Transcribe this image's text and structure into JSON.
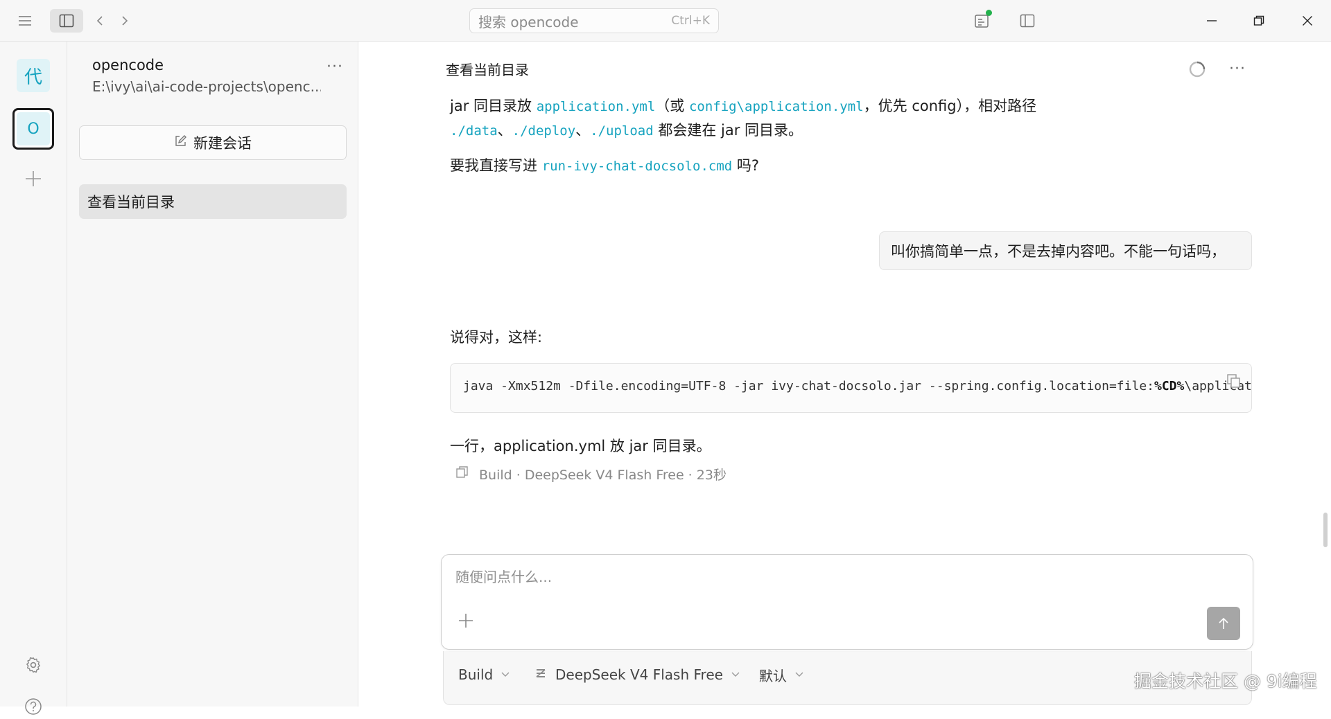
{
  "titlebar": {
    "search_placeholder": "搜索 opencode",
    "search_shortcut": "Ctrl+K",
    "icons": [
      "menu-icon",
      "sidebar-toggle-icon",
      "back-icon",
      "forward-icon",
      "review-icon",
      "panel-icon",
      "minimize-icon",
      "maximize-icon",
      "close-icon"
    ],
    "status_dot_color": "#22b14c"
  },
  "rail": {
    "tile_char": "代",
    "project_char": "O",
    "accent": "#16a3bf"
  },
  "sidebar": {
    "project_name": "opencode",
    "project_path": "E:\\ivy\\ai\\ai-code-projects\\openc...",
    "more": "···",
    "new_session_label": "新建会话",
    "sessions": [
      {
        "label": "查看当前目录",
        "active": true
      }
    ]
  },
  "main": {
    "chat_title": "查看当前目录",
    "more": "···",
    "assistant_prev": {
      "line1_a": "jar 同目录放 ",
      "line1_code1": "application.yml",
      "line1_b": "（或 ",
      "line1_code2": "config\\application.yml",
      "line1_c": "，优先 config），相对路径",
      "line2_code1": "./data",
      "line2_sep1": "、",
      "line2_code2": "./deploy",
      "line2_sep2": "、",
      "line2_code3": "./upload",
      "line2_b": " 都会建在 jar 同目录。",
      "line3_a": "要我直接写进 ",
      "line3_code": "run-ivy-chat-docsolo.cmd",
      "line3_b": " 吗?"
    },
    "user_message": "叫你搞简单一点，不是去掉内容吧。不能一句话吗，",
    "assistant_reply": {
      "intro": "说得对，这样:",
      "code_pre": "java -Xmx512m -Dfile.encoding=UTF-8 -jar ivy-chat-docsolo.jar --spring.config.location=file:",
      "code_bold": "%CD%",
      "code_post": "\\applicat",
      "outro": "一行，application.yml 放 jar 同目录。",
      "meta": "Build · DeepSeek V4 Flash Free · 23秒"
    }
  },
  "composer": {
    "placeholder": "随便问点什么...",
    "agent": "Build",
    "model": "DeepSeek V4 Flash Free",
    "mode": "默认"
  },
  "watermark": "掘金技术社区 @ 9i编程"
}
